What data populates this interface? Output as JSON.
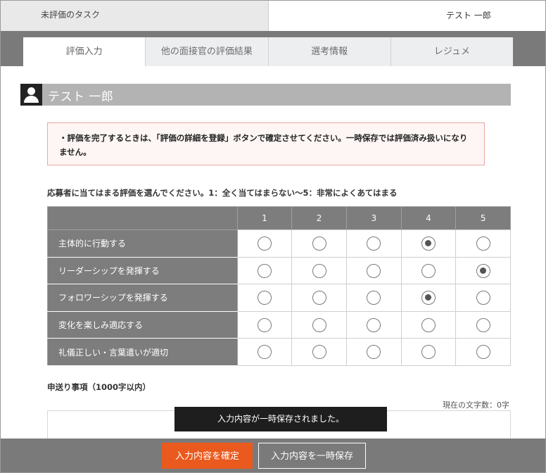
{
  "header": {
    "left_title": "未評価のタスク",
    "right_title": "テスト 一郎"
  },
  "tabs": [
    {
      "label": "評価入力",
      "active": true
    },
    {
      "label": "他の面接官の評価結果",
      "active": false
    },
    {
      "label": "選考情報",
      "active": false
    },
    {
      "label": "レジュメ",
      "active": false
    }
  ],
  "candidate": {
    "name": "テスト 一郎",
    "icon": "person-icon"
  },
  "notice": {
    "text": "・評価を完了するときは、「評価の詳細を登録」ボタンで確定させてください。一時保存では評価済み扱いになりません。"
  },
  "instruction": "応募者に当てはまる評価を選んでください。1：全く当てはまらない～5：非常によくあてはまる",
  "scale": [
    "1",
    "2",
    "3",
    "4",
    "5"
  ],
  "criteria": [
    {
      "label": "主体的に行動する",
      "selected": 4
    },
    {
      "label": "リーダーシップを発揮する",
      "selected": 5
    },
    {
      "label": "フォロワーシップを発揮する",
      "selected": 4
    },
    {
      "label": "変化を楽しみ適応する",
      "selected": null
    },
    {
      "label": "礼儀正しい・言葉遣いが適切",
      "selected": null
    }
  ],
  "notes": {
    "label": "申送り事項（1000字以内）",
    "char_count": "現在の文字数：0字",
    "value": ""
  },
  "toast": "入力内容が一時保存されました。",
  "buttons": {
    "confirm": "入力内容を確定",
    "temp_save": "入力内容を一時保存"
  },
  "colors": {
    "accent": "#ea5a1e",
    "header_gray": "#7a7a7a",
    "notice_border": "#e9a7a2"
  }
}
